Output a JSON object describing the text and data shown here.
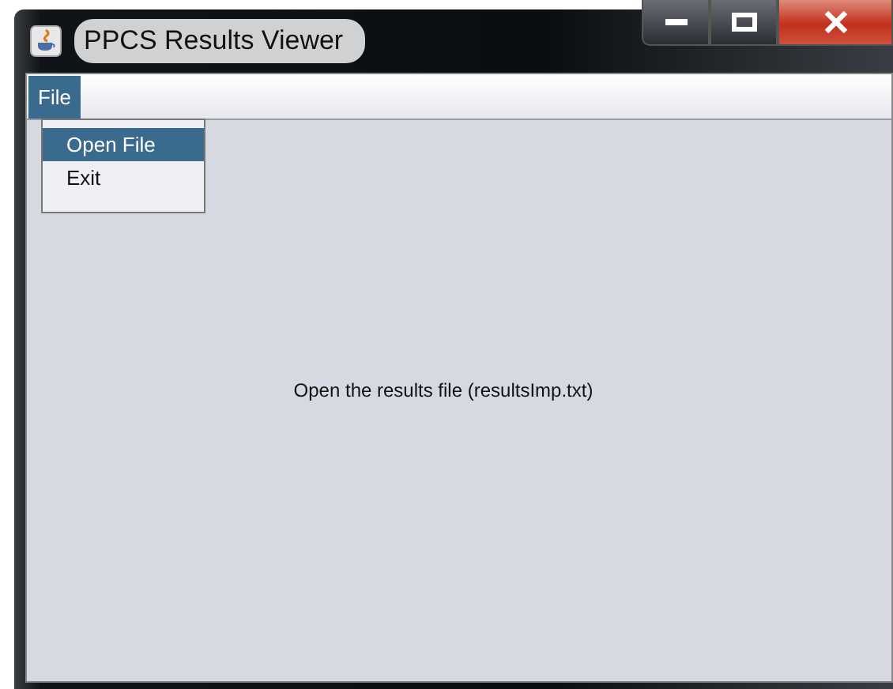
{
  "window": {
    "title": "PPCS Results Viewer"
  },
  "menu_bar": [
    {
      "label": "File",
      "selected": true
    }
  ],
  "dropdown": [
    {
      "label": "Open File",
      "selected": true
    },
    {
      "label": "Exit",
      "selected": false
    }
  ],
  "message": "Open the results file (resultsImp.txt)"
}
